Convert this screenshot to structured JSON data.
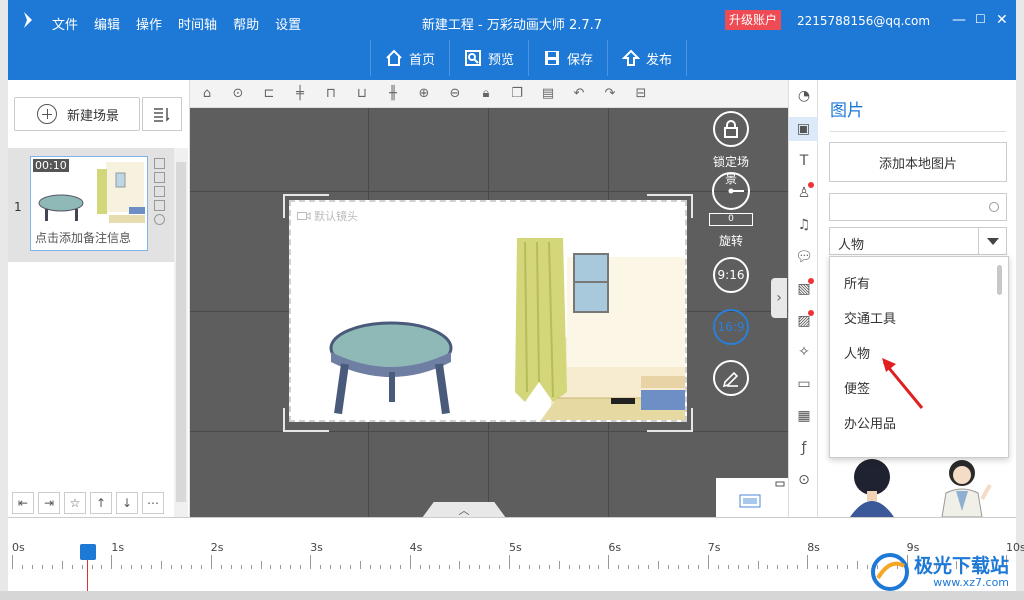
{
  "app": {
    "menu": [
      "文件",
      "编辑",
      "操作",
      "时间轴",
      "帮助",
      "设置"
    ],
    "title": "新建工程 - 万彩动画大师 2.7.7",
    "upgrade": "升级账户",
    "account": "2215788156@qq.com",
    "win_controls": [
      "—",
      "☐",
      "✕"
    ]
  },
  "toolbar": {
    "home": "首页",
    "preview": "预览",
    "save": "保存",
    "publish": "发布"
  },
  "left": {
    "new_scene": "新建场景",
    "scene": {
      "number": "1",
      "time": "00:10",
      "note": "点击添加备注信息"
    }
  },
  "canvas": {
    "camera_label": "默认镜头",
    "lock_label": "锁定场景",
    "rotate_value": "0",
    "rotate_label": "旋转",
    "ratio_916": "9:16",
    "ratio_169": "16:9"
  },
  "right": {
    "title": "图片",
    "add_local": "添加本地图片",
    "search_placeholder": "",
    "selected_category": "人物",
    "options": [
      "所有",
      "交通工具",
      "人物",
      "便签",
      "办公用品"
    ]
  },
  "timeline": {
    "labels": [
      "0s",
      "1s",
      "2s",
      "3s",
      "4s",
      "5s",
      "6s",
      "7s",
      "8s",
      "9s",
      "10s"
    ]
  },
  "watermark": {
    "name": "极光下载站",
    "url": "www.xz7.com"
  },
  "colors": {
    "brand": "#1d78d6",
    "upgrade": "#ef4b54",
    "canvas_bg": "#5e5e5e",
    "table": "#8fb9b7",
    "curtain": "#d4d67a"
  }
}
